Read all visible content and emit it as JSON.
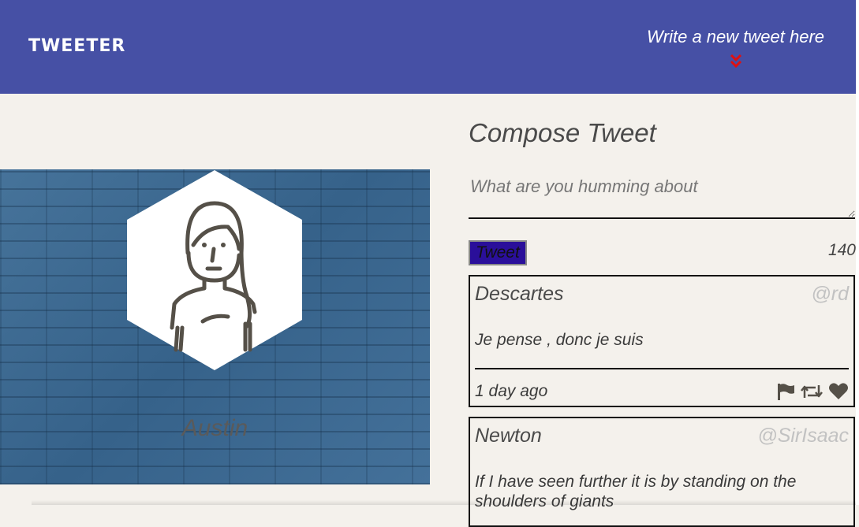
{
  "nav": {
    "brand": "TWEETER",
    "compose_toggle": "Write a new tweet here",
    "chevron_icon": "double-chevron-down-icon",
    "bg_color": "#4650a5",
    "accent_color": "#e01010"
  },
  "profile": {
    "username": "Austin",
    "avatar_icon": "person-avatar-icon"
  },
  "compose": {
    "title": "Compose Tweet",
    "placeholder": "What are you humming about",
    "submit_label": "Tweet",
    "counter": "140"
  },
  "tweets": [
    {
      "name": "Descartes",
      "handle": "@rd",
      "content": "Je pense , donc je suis",
      "time": "1 day ago",
      "actions": [
        "flag-icon",
        "retweet-icon",
        "heart-icon"
      ]
    },
    {
      "name": "Newton",
      "handle": "@SirIsaac",
      "content": "If I have seen further it is by standing on the shoulders of giants"
    }
  ]
}
